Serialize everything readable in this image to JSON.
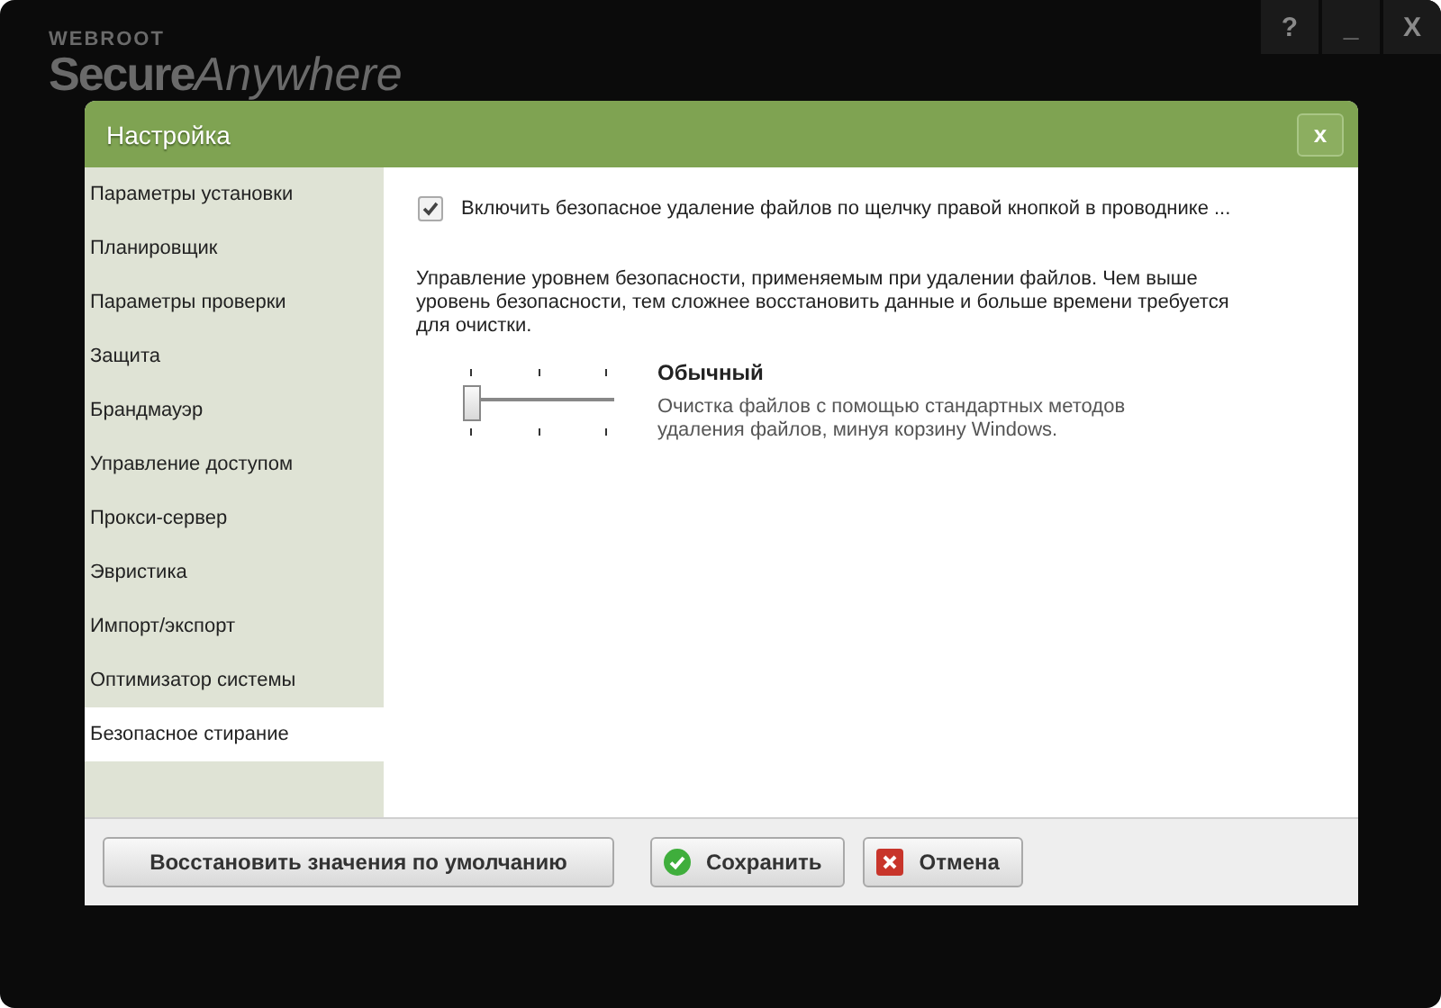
{
  "background_app": {
    "logo_top": "WEBROOT",
    "logo_main": "Secure",
    "logo_italic": "Anywhere",
    "window_buttons": [
      "?",
      "_",
      "X"
    ]
  },
  "dialog": {
    "title": "Настройка",
    "close": "x"
  },
  "sidebar": {
    "items": [
      {
        "label": "Параметры установки",
        "selected": false
      },
      {
        "label": "Планировщик",
        "selected": false
      },
      {
        "label": "Параметры проверки",
        "selected": false
      },
      {
        "label": "Защита",
        "selected": false
      },
      {
        "label": "Брандмауэр",
        "selected": false
      },
      {
        "label": "Управление доступом",
        "selected": false
      },
      {
        "label": "Прокси-сервер",
        "selected": false
      },
      {
        "label": "Эвристика",
        "selected": false
      },
      {
        "label": "Импорт/экспорт",
        "selected": false
      },
      {
        "label": "Оптимизатор системы",
        "selected": false
      },
      {
        "label": "Безопасное стирание",
        "selected": true
      }
    ]
  },
  "content": {
    "checkbox": {
      "label": "Включить безопасное удаление файлов по щелчку правой кнопкой в проводнике ...",
      "checked": true
    },
    "description": "Управление уровнем безопасности, применяемым при удалении файлов. Чем выше уровень безопасности, тем сложнее восстановить данные и больше времени требуется для очистки.",
    "slider": {
      "level": 0
    },
    "level_title": "Обычный",
    "level_description": "Очистка файлов с помощью стандартных методов удаления файлов, минуя корзину Windows."
  },
  "buttons": [
    {
      "label": "Восстановить значения по умолчанию",
      "kind": "plain"
    },
    {
      "label": "Сохранить",
      "kind": "ok"
    },
    {
      "label": "Отмена",
      "kind": "cancel"
    }
  ]
}
